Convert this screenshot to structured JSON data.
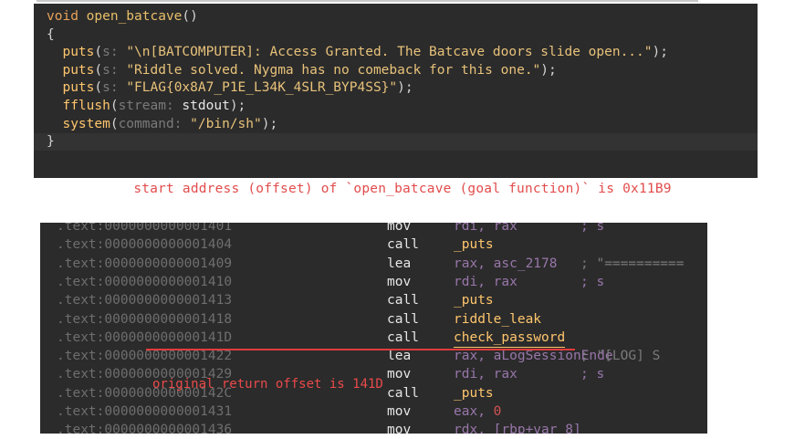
{
  "decompiler": {
    "lines": [
      [
        {
          "t": "void ",
          "c": "kw"
        },
        {
          "t": "open_batcave",
          "c": "fn"
        },
        {
          "t": "()",
          "c": "br"
        }
      ],
      [
        {
          "t": "{",
          "c": "br"
        }
      ],
      [
        {
          "t": "  puts",
          "c": "fn2"
        },
        {
          "t": "(",
          "c": "br"
        },
        {
          "t": "s: ",
          "c": "hint"
        },
        {
          "t": "\"\\n[BATCOMPUTER]: Access Granted. The Batcave doors slide open...\"",
          "c": "str"
        },
        {
          "t": ");",
          "c": "br"
        }
      ],
      [
        {
          "t": "  puts",
          "c": "fn2"
        },
        {
          "t": "(",
          "c": "br"
        },
        {
          "t": "s: ",
          "c": "hint"
        },
        {
          "t": "\"Riddle solved. Nygma has no comeback for this one.\"",
          "c": "str"
        },
        {
          "t": ");",
          "c": "br"
        }
      ],
      [
        {
          "t": "  puts",
          "c": "fn2"
        },
        {
          "t": "(",
          "c": "br"
        },
        {
          "t": "s: ",
          "c": "hint"
        },
        {
          "t": "\"FLAG{0x8A7_P1E_L34K_4SLR_BYP4SS}\"",
          "c": "str"
        },
        {
          "t": ");",
          "c": "br"
        }
      ],
      [
        {
          "t": "  fflush",
          "c": "fn2"
        },
        {
          "t": "(",
          "c": "br"
        },
        {
          "t": "stream: ",
          "c": "hint"
        },
        {
          "t": "stdout",
          "c": "plain"
        },
        {
          "t": ");",
          "c": "br"
        }
      ],
      [
        {
          "t": "  system",
          "c": "fn2"
        },
        {
          "t": "(",
          "c": "br"
        },
        {
          "t": "command: ",
          "c": "hint"
        },
        {
          "t": "\"/bin/sh\"",
          "c": "str"
        },
        {
          "t": ");",
          "c": "br"
        }
      ],
      [
        {
          "t": "}",
          "c": "br"
        }
      ]
    ]
  },
  "caption": "start address (offset) of `open_batcave (goal function)` is 0x11B9",
  "disassembly": {
    "rows": [
      {
        "addr": ".text:0000000000001401",
        "mn": "mov",
        "op": "rdi, rax",
        "cm": "; s"
      },
      {
        "addr": ".text:0000000000001404",
        "mn": "call",
        "op": "_puts",
        "cm": ""
      },
      {
        "addr": ".text:0000000000001409",
        "mn": "lea",
        "op": "rax, asc_2178",
        "cm": "; \"=========="
      },
      {
        "addr": ".text:0000000000001410",
        "mn": "mov",
        "op": "rdi, rax",
        "cm": "; s"
      },
      {
        "addr": ".text:0000000000001413",
        "mn": "call",
        "op": "_puts",
        "cm": ""
      },
      {
        "addr": ".text:0000000000001418",
        "mn": "call",
        "op": "riddle_leak",
        "cm": ""
      },
      {
        "addr": ".text:000000000000141D",
        "mn": "call",
        "op": "check_password",
        "cm": ""
      },
      {
        "addr": ".text:0000000000001422",
        "mn": "lea",
        "op": "rax, aLogSessionEnde",
        "cm": "; \"[LOG] S"
      },
      {
        "addr": ".text:0000000000001429",
        "mn": "mov",
        "op": "rdi, rax",
        "cm": "; s"
      },
      {
        "addr": ".text:000000000000142C",
        "mn": "call",
        "op": "_puts",
        "cm": ""
      },
      {
        "addr": ".text:0000000000001431",
        "mn": "mov",
        "op": "eax, 0",
        "cm": ""
      },
      {
        "addr": ".text:0000000000001436",
        "mn": "mov",
        "op": "rdx, [rbp+var_8]",
        "cm": ""
      }
    ]
  },
  "annotation": "original return offset is 141D"
}
